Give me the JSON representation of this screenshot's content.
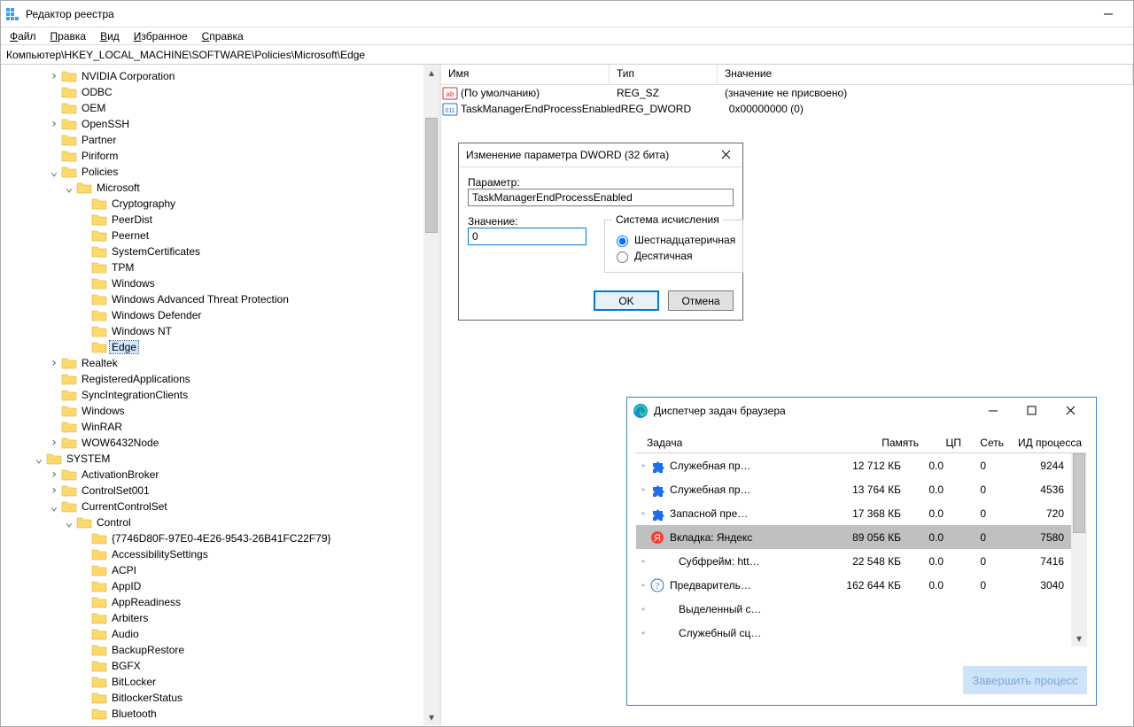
{
  "window_title": "Редактор реестра",
  "menu": [
    "Файл",
    "Правка",
    "Вид",
    "Избранное",
    "Справка"
  ],
  "address": "Компьютер\\HKEY_LOCAL_MACHINE\\SOFTWARE\\Policies\\Microsoft\\Edge",
  "tree": [
    {
      "depth": 3,
      "twist": ">",
      "label": "NVIDIA Corporation"
    },
    {
      "depth": 3,
      "twist": "",
      "label": "ODBC"
    },
    {
      "depth": 3,
      "twist": "",
      "label": "OEM"
    },
    {
      "depth": 3,
      "twist": ">",
      "label": "OpenSSH"
    },
    {
      "depth": 3,
      "twist": "",
      "label": "Partner"
    },
    {
      "depth": 3,
      "twist": "",
      "label": "Piriform"
    },
    {
      "depth": 3,
      "twist": "v",
      "label": "Policies"
    },
    {
      "depth": 4,
      "twist": "v",
      "label": "Microsoft"
    },
    {
      "depth": 5,
      "twist": "",
      "label": "Cryptography"
    },
    {
      "depth": 5,
      "twist": "",
      "label": "PeerDist"
    },
    {
      "depth": 5,
      "twist": "",
      "label": "Peernet"
    },
    {
      "depth": 5,
      "twist": "",
      "label": "SystemCertificates"
    },
    {
      "depth": 5,
      "twist": "",
      "label": "TPM"
    },
    {
      "depth": 5,
      "twist": "",
      "label": "Windows"
    },
    {
      "depth": 5,
      "twist": "",
      "label": "Windows Advanced Threat Protection"
    },
    {
      "depth": 5,
      "twist": "",
      "label": "Windows Defender"
    },
    {
      "depth": 5,
      "twist": "",
      "label": "Windows NT"
    },
    {
      "depth": 5,
      "twist": "",
      "label": "Edge",
      "selected": true
    },
    {
      "depth": 3,
      "twist": ">",
      "label": "Realtek"
    },
    {
      "depth": 3,
      "twist": "",
      "label": "RegisteredApplications"
    },
    {
      "depth": 3,
      "twist": "",
      "label": "SyncIntegrationClients"
    },
    {
      "depth": 3,
      "twist": "",
      "label": "Windows"
    },
    {
      "depth": 3,
      "twist": "",
      "label": "WinRAR"
    },
    {
      "depth": 3,
      "twist": ">",
      "label": "WOW6432Node"
    },
    {
      "depth": 2,
      "twist": "v",
      "label": "SYSTEM"
    },
    {
      "depth": 3,
      "twist": ">",
      "label": "ActivationBroker"
    },
    {
      "depth": 3,
      "twist": ">",
      "label": "ControlSet001"
    },
    {
      "depth": 3,
      "twist": "v",
      "label": "CurrentControlSet"
    },
    {
      "depth": 4,
      "twist": "v",
      "label": "Control"
    },
    {
      "depth": 5,
      "twist": "",
      "label": "{7746D80F-97E0-4E26-9543-26B41FC22F79}"
    },
    {
      "depth": 5,
      "twist": "",
      "label": "AccessibilitySettings"
    },
    {
      "depth": 5,
      "twist": "",
      "label": "ACPI"
    },
    {
      "depth": 5,
      "twist": "",
      "label": "AppID"
    },
    {
      "depth": 5,
      "twist": "",
      "label": "AppReadiness"
    },
    {
      "depth": 5,
      "twist": "",
      "label": "Arbiters"
    },
    {
      "depth": 5,
      "twist": "",
      "label": "Audio"
    },
    {
      "depth": 5,
      "twist": "",
      "label": "BackupRestore"
    },
    {
      "depth": 5,
      "twist": "",
      "label": "BGFX"
    },
    {
      "depth": 5,
      "twist": "",
      "label": "BitLocker"
    },
    {
      "depth": 5,
      "twist": "",
      "label": "BitlockerStatus"
    },
    {
      "depth": 5,
      "twist": "",
      "label": "Bluetooth"
    }
  ],
  "values_header": {
    "name": "Имя",
    "type": "Тип",
    "value": "Значение"
  },
  "values": [
    {
      "icon": "str",
      "name": "(По умолчанию)",
      "type": "REG_SZ",
      "value": "(значение не присвоено)"
    },
    {
      "icon": "bin",
      "name": "TaskManagerEndProcessEnabled",
      "type": "REG_DWORD",
      "value": "0x00000000 (0)"
    }
  ],
  "dword_dialog": {
    "title": "Изменение параметра DWORD (32 бита)",
    "param_label": "Параметр:",
    "param_value": "TaskManagerEndProcessEnabled",
    "value_label": "Значение:",
    "value_value": "0",
    "base_legend": "Система исчисления",
    "base_hex": "Шестнадцатеричная",
    "base_dec": "Десятичная",
    "ok": "OK",
    "cancel": "Отмена"
  },
  "tm": {
    "title": "Диспетчер задач браузера",
    "headers": {
      "task": "Задача",
      "memory": "Память",
      "cpu": "ЦП",
      "net": "Сеть",
      "pid": "ИД процесса"
    },
    "rows": [
      {
        "icon": "puzzle",
        "indent": 0,
        "name": "Служебная пр…",
        "mem": "12 712 КБ",
        "cpu": "0.0",
        "net": "0",
        "pid": "9244"
      },
      {
        "icon": "puzzle",
        "indent": 0,
        "name": "Служебная пр…",
        "mem": "13 764 КБ",
        "cpu": "0.0",
        "net": "0",
        "pid": "4536"
      },
      {
        "icon": "puzzle",
        "indent": 0,
        "name": "Запасной пре…",
        "mem": "17 368 КБ",
        "cpu": "0.0",
        "net": "0",
        "pid": "720"
      },
      {
        "icon": "ya",
        "indent": 0,
        "name": "Вкладка: Яндекс",
        "mem": "89 056 КБ",
        "cpu": "0.0",
        "net": "0",
        "pid": "7580",
        "selected": true
      },
      {
        "icon": "",
        "indent": 1,
        "name": "Субфрейм: htt…",
        "mem": "22 548 КБ",
        "cpu": "0.0",
        "net": "0",
        "pid": "7416"
      },
      {
        "icon": "q",
        "indent": 0,
        "name": "Предваритель…",
        "mem": "162 644 КБ",
        "cpu": "0.0",
        "net": "0",
        "pid": "3040"
      },
      {
        "icon": "",
        "indent": 1,
        "name": "Выделенный с…",
        "mem": "",
        "cpu": "",
        "net": "",
        "pid": ""
      },
      {
        "icon": "",
        "indent": 1,
        "name": "Служебный сц…",
        "mem": "",
        "cpu": "",
        "net": "",
        "pid": ""
      }
    ],
    "end_btn": "Завершить процесс"
  }
}
